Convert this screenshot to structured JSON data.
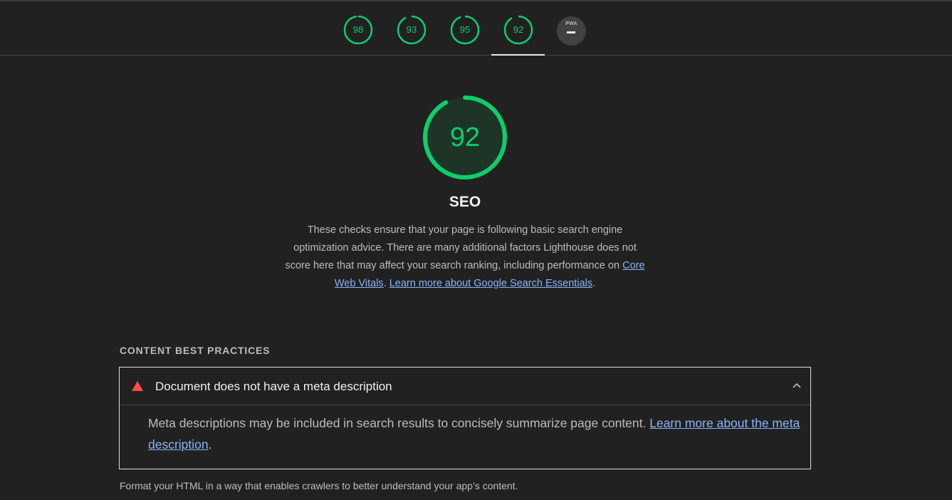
{
  "nav": {
    "scores": [
      {
        "value": "98",
        "fraction": 0.98,
        "color": "#0cce6b"
      },
      {
        "value": "93",
        "fraction": 0.93,
        "color": "#0cce6b"
      },
      {
        "value": "95",
        "fraction": 0.95,
        "color": "#0cce6b"
      },
      {
        "value": "92",
        "fraction": 0.92,
        "color": "#0cce6b",
        "active": true
      }
    ],
    "pwa_label": "PWA"
  },
  "category": {
    "score": "92",
    "score_fraction": 0.92,
    "score_color": "#0cce6b",
    "title": "SEO",
    "description_lead": "These checks ensure that your page is following basic search engine optimization advice. There are many additional factors Lighthouse does not score here that may affect your search ranking, including performance on ",
    "link1": "Core Web Vitals",
    "separator": ". ",
    "link2": "Learn more about Google Search Essentials",
    "description_end": "."
  },
  "group": {
    "title": "CONTENT BEST PRACTICES",
    "description": "Format your HTML in a way that enables crawlers to better understand your app’s content."
  },
  "audit": {
    "status_icon": "fail-triangle-icon",
    "fail_color": "#ff4e42",
    "title": "Document does not have a meta description",
    "description": "Meta descriptions may be included in search results to concisely summarize page content. ",
    "link": "Learn more about the meta description",
    "description_end": "."
  }
}
